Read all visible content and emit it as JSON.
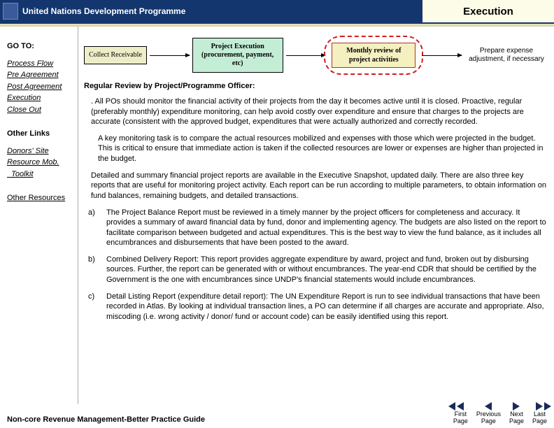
{
  "header": {
    "org": "United Nations Development Programme",
    "title": "Execution"
  },
  "sidebar": {
    "goto_label": "GO TO:",
    "goto_links": [
      "Process Flow",
      "Pre Agreement",
      "Post Agreement",
      "Execution",
      "Close Out"
    ],
    "other_links_label": "Other Links",
    "other_links": [
      "Donors' Site",
      "Resource Mob.",
      "  Toolkit"
    ],
    "other_resources": "Other Resources"
  },
  "flow": {
    "b1": "Collect Receivable",
    "b2": "Project Execution (procurement, payment, etc)",
    "b3": "Monthly review of project activities",
    "b4": "Prepare expense adjustment, if necessary"
  },
  "content": {
    "subhead": "Regular Review by Project/Programme Officer:",
    "p1": ". All POs should monitor the financial activity of their projects  from the day it becomes active until it is closed. Proactive, regular (preferably monthly) expenditure monitoring, can help avoid costly over expenditure and ensure that charges to the projects are accurate (consistent with the approved budget, expenditures that were actually authorized and correctly recorded.",
    "p2": "A key monitoring task is to compare the actual resources mobilized and  expenses with those which were projected in the budget.    This is critical to ensure that immediate action is taken if the collected resources are lower or expenses are higher than projected in the budget.",
    "p3": "Detailed and summary financial project reports are available in the Executive Snapshot, updated daily. There are also three key reports that are useful for monitoring project activity. Each report can be run according to multiple parameters, to obtain information on fund balances, remaining budgets, and detailed  transactions.",
    "items": [
      {
        "marker": "a)",
        "text": "The Project Balance Report must be reviewed in a timely manner by the project officers for completeness and accuracy. It provides a summary of award financial data by fund, donor and implementing agency. The budgets are also listed on the report to facilitate comparison between budgeted and actual expenditures. This is the best way to view the fund balance, as it includes all encumbrances and disbursements that have been posted to the award."
      },
      {
        "marker": "b)",
        "text": "Combined Delivery Report: This report provides aggregate expenditure by award, project and fund, broken out by disbursing sources.  Further, the report can be generated with or without encumbrances. The year-end CDR that should be certified by the Government is the one with encumbrances since UNDP's  financial statements would include encumbrances."
      },
      {
        "marker": "c)",
        "text": "Detail Listing Report (expenditure detail report):  The UN Expenditure Report is run to see individual transactions that have been recorded in Atlas.  By looking at individual transaction lines, a PO can determine if all charges are accurate and appropriate. Also, miscoding (i.e. wrong activity / donor/ fund or account code) can be easily identified using this report."
      }
    ]
  },
  "footer": {
    "title": "Non-core Revenue Management-Better Practice Guide",
    "nav": [
      "First Page",
      "Previous Page",
      "Next Page",
      "Last Page"
    ]
  }
}
